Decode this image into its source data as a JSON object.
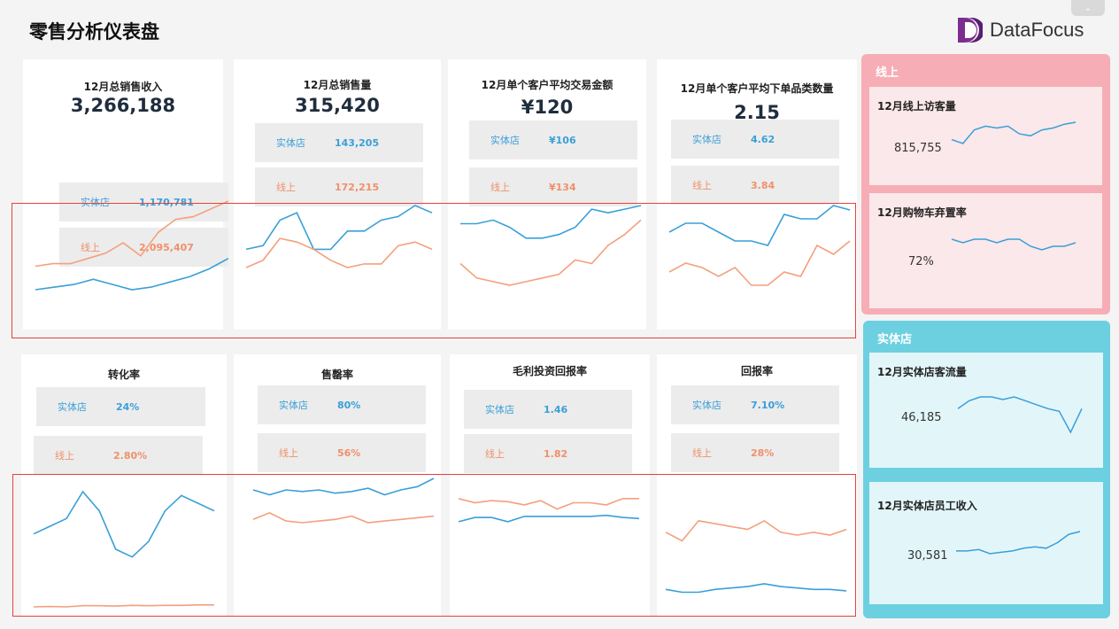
{
  "header": {
    "title": "零售分析仪表盘",
    "logo_text": "DataFocus",
    "collapse_glyph": "⌄"
  },
  "colors": {
    "blue": "#3a9fd8",
    "orange": "#f3a07c",
    "online_panel": "#f6adb5",
    "store_panel": "#6cd0e0"
  },
  "kpis": [
    {
      "title": "12月总销售收入",
      "value": "3,266,188",
      "store_label": "实体店",
      "store_value": "1,170,781",
      "online_label": "线上",
      "online_value": "2,095,407",
      "blue": [
        20,
        21,
        22,
        24,
        22,
        20,
        21,
        23,
        25,
        28,
        32
      ],
      "orange": [
        29,
        30,
        30,
        32,
        34,
        38,
        33,
        42,
        47,
        48,
        51,
        54
      ]
    },
    {
      "title": "12月总销售量",
      "value": "315,420",
      "store_label": "实体店",
      "store_value": "143,205",
      "online_label": "线上",
      "online_value": "172,215",
      "blue": [
        40,
        41,
        48,
        50,
        40,
        40,
        45,
        45,
        48,
        49,
        52,
        50
      ],
      "orange": [
        35,
        37,
        43,
        42,
        40,
        37,
        35,
        36,
        36,
        41,
        42,
        40
      ]
    },
    {
      "title": "12月单个客户平均交易金额",
      "value": "¥120",
      "store_label": "实体店",
      "store_value": "¥106",
      "online_label": "线上",
      "online_value": "¥134",
      "blue": [
        105,
        105,
        106,
        104,
        101,
        101,
        102,
        104,
        109,
        108,
        109,
        110
      ],
      "orange": [
        94,
        90,
        89,
        88,
        89,
        90,
        91,
        95,
        94,
        99,
        102,
        106
      ]
    },
    {
      "title": "12月单个客户平均下单品类数量",
      "value": "2.15",
      "store_label": "实体店",
      "store_value": "4.62",
      "online_label": "线上",
      "online_value": "3.84",
      "blue": [
        4.4,
        4.6,
        4.6,
        4.4,
        4.2,
        4.2,
        4.1,
        4.8,
        4.7,
        4.7,
        5.0,
        4.9
      ],
      "orange": [
        3.5,
        3.7,
        3.6,
        3.4,
        3.6,
        3.2,
        3.2,
        3.5,
        3.4,
        4.1,
        3.9,
        4.2
      ]
    },
    {
      "title": "转化率",
      "value": "",
      "store_label": "实体店",
      "store_value": "24%",
      "online_label": "线上",
      "online_value": "2.80%",
      "blue": [
        20,
        22,
        24,
        31,
        26,
        16,
        14,
        18,
        26,
        30,
        28,
        26
      ],
      "orange": [
        1.0,
        1.1,
        1.0,
        1.3,
        1.3,
        1.2,
        1.4,
        1.3,
        1.4,
        1.4,
        1.5,
        1.5
      ]
    },
    {
      "title": "售罄率",
      "value": "",
      "store_label": "实体店",
      "store_value": "80%",
      "online_label": "线上",
      "online_value": "56%",
      "blue": [
        80,
        77,
        80,
        79,
        80,
        78,
        79,
        81,
        77,
        80,
        82,
        87
      ],
      "orange": [
        62,
        66,
        61,
        60,
        61,
        62,
        64,
        60,
        61,
        62,
        63,
        64
      ]
    },
    {
      "title": "毛利投资回报率",
      "value": "",
      "store_label": "实体店",
      "store_value": "1.46",
      "online_label": "线上",
      "online_value": "1.82",
      "blue": [
        1.46,
        1.5,
        1.5,
        1.46,
        1.51,
        1.51,
        1.51,
        1.51,
        1.51,
        1.52,
        1.5,
        1.49
      ],
      "orange": [
        1.68,
        1.64,
        1.66,
        1.65,
        1.62,
        1.66,
        1.58,
        1.64,
        1.64,
        1.62,
        1.68,
        1.68
      ],
      "ylim": [
        1.4,
        1.72
      ]
    },
    {
      "title": "回报率",
      "value": "",
      "store_label": "实体店",
      "store_value": "7.10%",
      "online_label": "线上",
      "online_value": "28%",
      "blue": [
        8,
        7,
        7,
        8,
        8.5,
        9,
        10,
        9,
        8.5,
        8,
        8,
        7.5
      ],
      "orange": [
        28,
        25,
        32,
        31,
        30,
        29,
        32,
        28,
        27,
        28,
        27,
        29
      ],
      "ylim": [
        5,
        36
      ]
    }
  ],
  "online": {
    "title": "线上",
    "visitors": {
      "title": "12月线上访客量",
      "value": "815,755",
      "trend": [
        80,
        78,
        85,
        87,
        86,
        87,
        83,
        82,
        85,
        86,
        88,
        89
      ]
    },
    "cart": {
      "title": "12月购物车弃置率",
      "value": "72%",
      "trend": [
        72,
        71,
        72,
        72,
        71,
        72,
        72,
        70,
        69,
        70,
        70,
        71
      ]
    }
  },
  "store": {
    "title": "实体店",
    "traffic": {
      "title": "12月实体店客流量",
      "value": "46,185",
      "trend": [
        46,
        52,
        55,
        55,
        53,
        55,
        52,
        49,
        46,
        44,
        28,
        46
      ]
    },
    "salary": {
      "title": "12月实体店员工收入",
      "value": "30,581",
      "trend": [
        30,
        30,
        31,
        28,
        29,
        30,
        32,
        33,
        32,
        36,
        42,
        44
      ]
    }
  }
}
